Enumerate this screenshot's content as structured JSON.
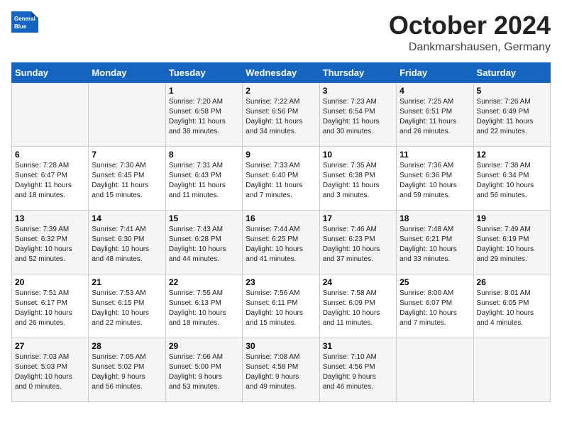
{
  "header": {
    "logo_general": "General",
    "logo_blue": "Blue",
    "month_title": "October 2024",
    "location": "Dankmarshausen, Germany"
  },
  "days_of_week": [
    "Sunday",
    "Monday",
    "Tuesday",
    "Wednesday",
    "Thursday",
    "Friday",
    "Saturday"
  ],
  "weeks": [
    [
      {
        "day": "",
        "info": ""
      },
      {
        "day": "",
        "info": ""
      },
      {
        "day": "1",
        "info": "Sunrise: 7:20 AM\nSunset: 6:58 PM\nDaylight: 11 hours\nand 38 minutes."
      },
      {
        "day": "2",
        "info": "Sunrise: 7:22 AM\nSunset: 6:56 PM\nDaylight: 11 hours\nand 34 minutes."
      },
      {
        "day": "3",
        "info": "Sunrise: 7:23 AM\nSunset: 6:54 PM\nDaylight: 11 hours\nand 30 minutes."
      },
      {
        "day": "4",
        "info": "Sunrise: 7:25 AM\nSunset: 6:51 PM\nDaylight: 11 hours\nand 26 minutes."
      },
      {
        "day": "5",
        "info": "Sunrise: 7:26 AM\nSunset: 6:49 PM\nDaylight: 11 hours\nand 22 minutes."
      }
    ],
    [
      {
        "day": "6",
        "info": "Sunrise: 7:28 AM\nSunset: 6:47 PM\nDaylight: 11 hours\nand 18 minutes."
      },
      {
        "day": "7",
        "info": "Sunrise: 7:30 AM\nSunset: 6:45 PM\nDaylight: 11 hours\nand 15 minutes."
      },
      {
        "day": "8",
        "info": "Sunrise: 7:31 AM\nSunset: 6:43 PM\nDaylight: 11 hours\nand 11 minutes."
      },
      {
        "day": "9",
        "info": "Sunrise: 7:33 AM\nSunset: 6:40 PM\nDaylight: 11 hours\nand 7 minutes."
      },
      {
        "day": "10",
        "info": "Sunrise: 7:35 AM\nSunset: 6:38 PM\nDaylight: 11 hours\nand 3 minutes."
      },
      {
        "day": "11",
        "info": "Sunrise: 7:36 AM\nSunset: 6:36 PM\nDaylight: 10 hours\nand 59 minutes."
      },
      {
        "day": "12",
        "info": "Sunrise: 7:38 AM\nSunset: 6:34 PM\nDaylight: 10 hours\nand 56 minutes."
      }
    ],
    [
      {
        "day": "13",
        "info": "Sunrise: 7:39 AM\nSunset: 6:32 PM\nDaylight: 10 hours\nand 52 minutes."
      },
      {
        "day": "14",
        "info": "Sunrise: 7:41 AM\nSunset: 6:30 PM\nDaylight: 10 hours\nand 48 minutes."
      },
      {
        "day": "15",
        "info": "Sunrise: 7:43 AM\nSunset: 6:28 PM\nDaylight: 10 hours\nand 44 minutes."
      },
      {
        "day": "16",
        "info": "Sunrise: 7:44 AM\nSunset: 6:25 PM\nDaylight: 10 hours\nand 41 minutes."
      },
      {
        "day": "17",
        "info": "Sunrise: 7:46 AM\nSunset: 6:23 PM\nDaylight: 10 hours\nand 37 minutes."
      },
      {
        "day": "18",
        "info": "Sunrise: 7:48 AM\nSunset: 6:21 PM\nDaylight: 10 hours\nand 33 minutes."
      },
      {
        "day": "19",
        "info": "Sunrise: 7:49 AM\nSunset: 6:19 PM\nDaylight: 10 hours\nand 29 minutes."
      }
    ],
    [
      {
        "day": "20",
        "info": "Sunrise: 7:51 AM\nSunset: 6:17 PM\nDaylight: 10 hours\nand 26 minutes."
      },
      {
        "day": "21",
        "info": "Sunrise: 7:53 AM\nSunset: 6:15 PM\nDaylight: 10 hours\nand 22 minutes."
      },
      {
        "day": "22",
        "info": "Sunrise: 7:55 AM\nSunset: 6:13 PM\nDaylight: 10 hours\nand 18 minutes."
      },
      {
        "day": "23",
        "info": "Sunrise: 7:56 AM\nSunset: 6:11 PM\nDaylight: 10 hours\nand 15 minutes."
      },
      {
        "day": "24",
        "info": "Sunrise: 7:58 AM\nSunset: 6:09 PM\nDaylight: 10 hours\nand 11 minutes."
      },
      {
        "day": "25",
        "info": "Sunrise: 8:00 AM\nSunset: 6:07 PM\nDaylight: 10 hours\nand 7 minutes."
      },
      {
        "day": "26",
        "info": "Sunrise: 8:01 AM\nSunset: 6:05 PM\nDaylight: 10 hours\nand 4 minutes."
      }
    ],
    [
      {
        "day": "27",
        "info": "Sunrise: 7:03 AM\nSunset: 5:03 PM\nDaylight: 10 hours\nand 0 minutes."
      },
      {
        "day": "28",
        "info": "Sunrise: 7:05 AM\nSunset: 5:02 PM\nDaylight: 9 hours\nand 56 minutes."
      },
      {
        "day": "29",
        "info": "Sunrise: 7:06 AM\nSunset: 5:00 PM\nDaylight: 9 hours\nand 53 minutes."
      },
      {
        "day": "30",
        "info": "Sunrise: 7:08 AM\nSunset: 4:58 PM\nDaylight: 9 hours\nand 49 minutes."
      },
      {
        "day": "31",
        "info": "Sunrise: 7:10 AM\nSunset: 4:56 PM\nDaylight: 9 hours\nand 46 minutes."
      },
      {
        "day": "",
        "info": ""
      },
      {
        "day": "",
        "info": ""
      }
    ]
  ]
}
